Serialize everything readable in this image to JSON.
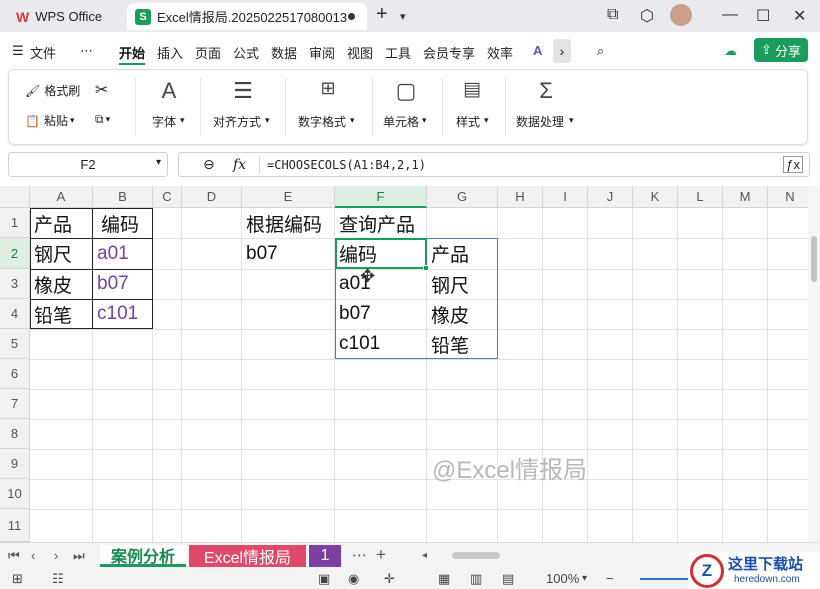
{
  "titlebar": {
    "app_tab": "WPS Office",
    "file_tab": "Excel情报局.2025022517080013",
    "file_icon_letter": "S",
    "new_tab": "+"
  },
  "menu": {
    "file": "文件",
    "more": "⋯",
    "items": [
      "开始",
      "插入",
      "页面",
      "公式",
      "数据",
      "审阅",
      "视图",
      "工具",
      "会员专享",
      "效率"
    ],
    "share": "分享"
  },
  "ribbon": {
    "format_painter": "格式刷",
    "paste": "粘贴",
    "groups": [
      "字体",
      "对齐方式",
      "数字格式",
      "单元格",
      "样式",
      "数据处理"
    ]
  },
  "formula_bar": {
    "name_box": "F2",
    "fx": "fx",
    "formula": "=CHOOSECOLS(A1:B4,2,1)"
  },
  "grid": {
    "columns": [
      "A",
      "B",
      "C",
      "D",
      "E",
      "F",
      "G",
      "H",
      "I",
      "J",
      "K",
      "L",
      "M",
      "N"
    ],
    "rows": [
      "1",
      "2",
      "3",
      "4",
      "5",
      "6",
      "7",
      "8",
      "9",
      "10",
      "11"
    ],
    "cells": {
      "A1": "产品",
      "B1": "编码",
      "E1": "根据编码",
      "F1": "查询产品",
      "A2": "钢尺",
      "B2": "a01",
      "E2": "b07",
      "F2": "编码",
      "G2": "产品",
      "A3": "橡皮",
      "B3": "b07",
      "F3": "a01",
      "G3": "钢尺",
      "A4": "铅笔",
      "B4": "c101",
      "F4": "b07",
      "G4": "橡皮",
      "F5": "c101",
      "G5": "铅笔"
    },
    "watermark": "@Excel情报局",
    "accent_color": "#1a9c5b",
    "code_color": "#7a3fa0"
  },
  "sheets": {
    "tabs": [
      "案例分析",
      "Excel情报局",
      "1"
    ],
    "more": "⋯",
    "add": "+"
  },
  "status": {
    "zoom": "100%",
    "promo_title": "这里下载站",
    "promo_url": "heredown.com"
  }
}
